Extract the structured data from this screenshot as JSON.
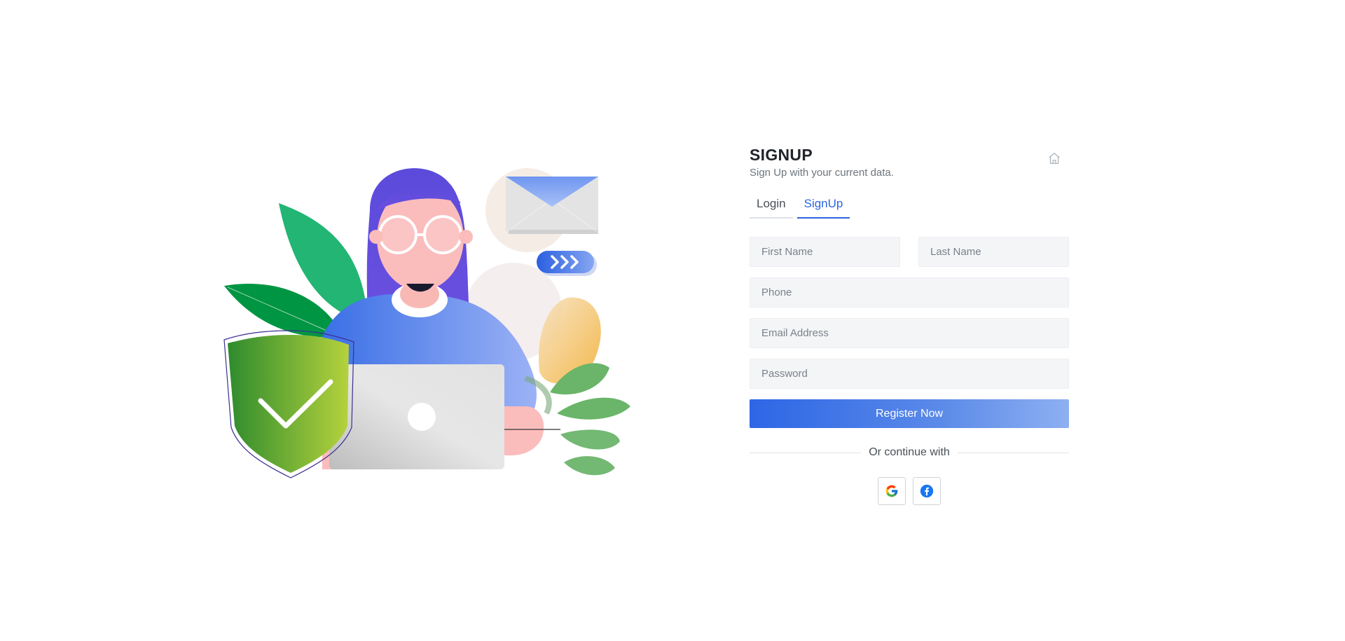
{
  "header": {
    "title": "SIGNUP",
    "subtitle": "Sign Up with your current data."
  },
  "icons": {
    "home": "home-icon",
    "google": "google-icon",
    "facebook": "facebook-icon"
  },
  "tabs": [
    {
      "label": "Login",
      "active": false
    },
    {
      "label": "SignUp",
      "active": true
    }
  ],
  "form": {
    "first_name": {
      "placeholder": "First Name",
      "value": ""
    },
    "last_name": {
      "placeholder": "Last Name",
      "value": ""
    },
    "phone": {
      "placeholder": "Phone",
      "value": ""
    },
    "email": {
      "placeholder": "Email Address",
      "value": ""
    },
    "password": {
      "placeholder": "Password",
      "value": ""
    },
    "submit_label": "Register Now"
  },
  "social": {
    "divider_text": "Or continue with"
  },
  "colors": {
    "accent": "#2a66e0",
    "button_start": "#2d66e6",
    "button_end": "#8eb0f2",
    "input_bg": "#f4f5f7"
  }
}
